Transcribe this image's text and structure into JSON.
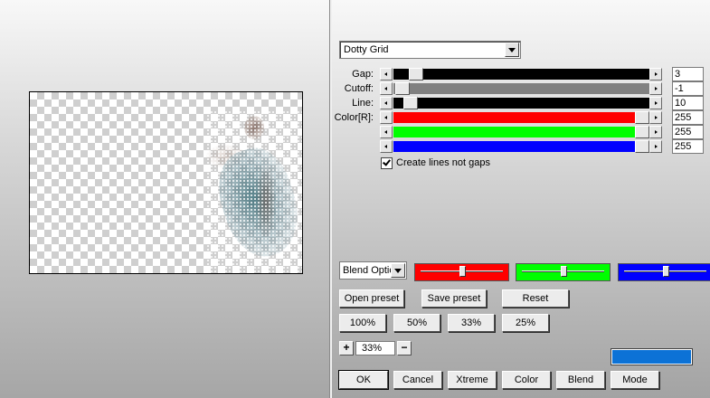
{
  "filter": {
    "preset_selected": "Dotty Grid"
  },
  "params": [
    {
      "label": "Gap:",
      "value": "3",
      "fill": 0.03,
      "track": "#000000"
    },
    {
      "label": "Cutoff:",
      "value": "-1",
      "fill": 0.0,
      "track": "#808080"
    },
    {
      "label": "Line:",
      "value": "10",
      "fill": 0.04,
      "track": "#000000"
    },
    {
      "label": "Color[R]:",
      "value": "255",
      "fill": 1.0,
      "track": "#ff0000"
    },
    {
      "label": "",
      "value": "255",
      "fill": 1.0,
      "track": "#00ff00"
    },
    {
      "label": "",
      "value": "255",
      "fill": 1.0,
      "track": "#0000ff"
    }
  ],
  "checkbox": {
    "label": "Create lines not gaps",
    "checked": true
  },
  "blend": {
    "mode_label": "Blend Options",
    "sliders": [
      {
        "color": "#ff0000",
        "level": 0.5
      },
      {
        "color": "#00ff00",
        "level": 0.5
      },
      {
        "color": "#0000ff",
        "level": 0.5
      }
    ]
  },
  "preset_buttons": {
    "open": "Open preset",
    "save": "Save preset",
    "reset": "Reset"
  },
  "zoom_buttons": [
    "100%",
    "50%",
    "33%",
    "25%"
  ],
  "zoom": {
    "plus": "+",
    "minus": "−",
    "value": "33%"
  },
  "swatch_color": "#0c72d6",
  "footer_buttons": {
    "ok": "OK",
    "cancel": "Cancel",
    "xtreme": "Xtreme",
    "color": "Color",
    "blend": "Blend",
    "mode": "Mode"
  }
}
